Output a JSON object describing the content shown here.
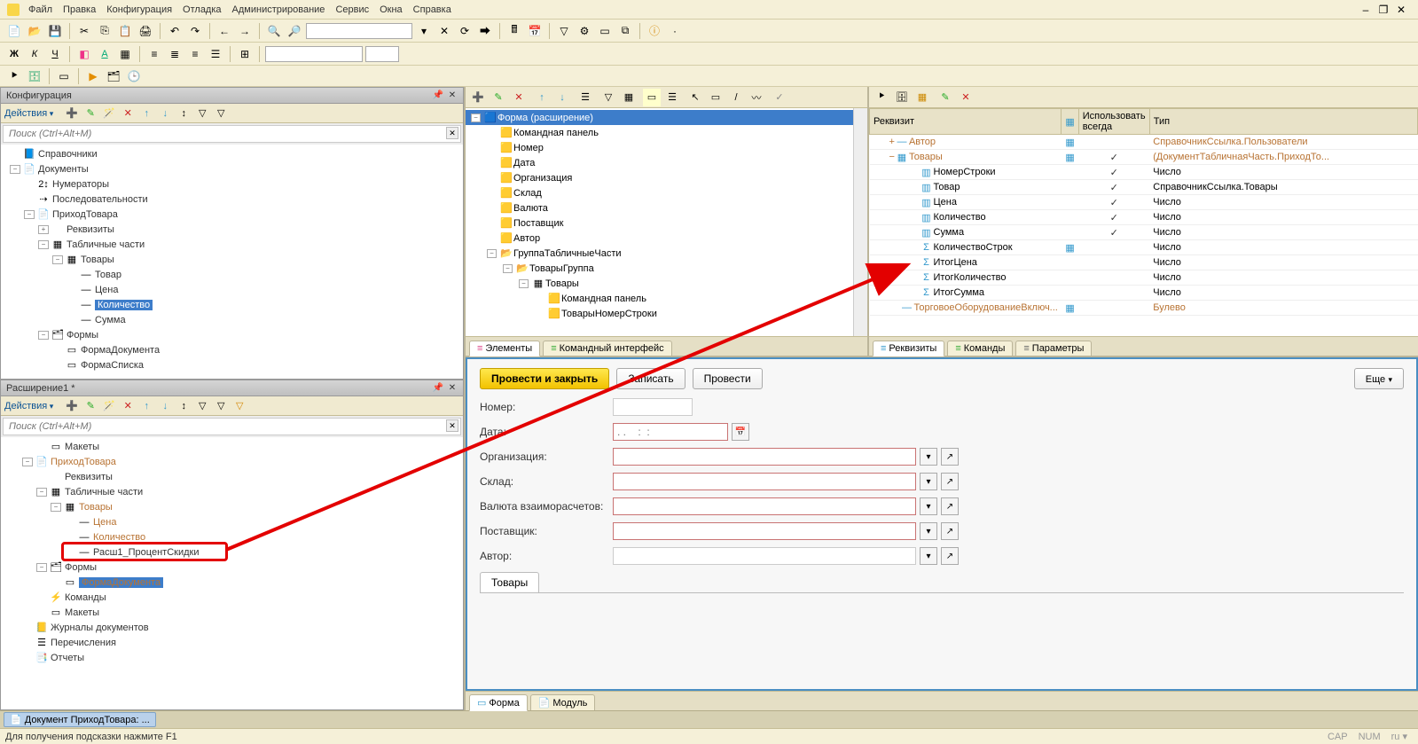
{
  "menu": {
    "file": "Файл",
    "edit": "Правка",
    "config": "Конфигурация",
    "debug": "Отладка",
    "admin": "Администрирование",
    "service": "Сервис",
    "windows": "Окна",
    "help": "Справка"
  },
  "panels": {
    "config": {
      "title": "Конфигурация",
      "actions": "Действия",
      "search_placeholder": "Поиск (Ctrl+Alt+M)",
      "tree": [
        {
          "lvl": 0,
          "exp": "",
          "icon": "📘",
          "label": "Справочники"
        },
        {
          "lvl": 0,
          "exp": "-",
          "icon": "📄",
          "label": "Документы"
        },
        {
          "lvl": 1,
          "exp": "",
          "icon": "2↕",
          "label": "Нумераторы"
        },
        {
          "lvl": 1,
          "exp": "",
          "icon": "⇢",
          "label": "Последовательности"
        },
        {
          "lvl": 1,
          "exp": "-",
          "icon": "📄",
          "label": "ПриходТовара"
        },
        {
          "lvl": 2,
          "exp": "+",
          "icon": "",
          "label": "Реквизиты"
        },
        {
          "lvl": 2,
          "exp": "-",
          "icon": "▦",
          "label": "Табличные части"
        },
        {
          "lvl": 3,
          "exp": "-",
          "icon": "▦",
          "label": "Товары"
        },
        {
          "lvl": 4,
          "exp": "",
          "icon": "—",
          "label": "Товар"
        },
        {
          "lvl": 4,
          "exp": "",
          "icon": "—",
          "label": "Цена"
        },
        {
          "lvl": 4,
          "exp": "",
          "icon": "—",
          "label": "Количество",
          "selected": true
        },
        {
          "lvl": 4,
          "exp": "",
          "icon": "—",
          "label": "Сумма"
        },
        {
          "lvl": 2,
          "exp": "-",
          "icon": "🗂",
          "label": "Формы"
        },
        {
          "lvl": 3,
          "exp": "",
          "icon": "▭",
          "label": "ФормаДокумента"
        },
        {
          "lvl": 3,
          "exp": "",
          "icon": "▭",
          "label": "ФормаСписка"
        }
      ]
    },
    "ext": {
      "title": "Расширение1 *",
      "actions": "Действия",
      "search_placeholder": "Поиск (Ctrl+Alt+M)",
      "tree": [
        {
          "lvl": 1,
          "exp": "",
          "icon": "▭",
          "label": "Макеты"
        },
        {
          "lvl": 0,
          "exp": "-",
          "icon": "📄",
          "label": "ПриходТовара",
          "orange": true
        },
        {
          "lvl": 1,
          "exp": "",
          "icon": "",
          "label": "Реквизиты"
        },
        {
          "lvl": 1,
          "exp": "-",
          "icon": "▦",
          "label": "Табличные части"
        },
        {
          "lvl": 2,
          "exp": "-",
          "icon": "▦",
          "label": "Товары",
          "orange": true
        },
        {
          "lvl": 3,
          "exp": "",
          "icon": "—",
          "label": "Цена",
          "orange": true
        },
        {
          "lvl": 3,
          "exp": "",
          "icon": "—",
          "label": "Количество",
          "orange": true
        },
        {
          "lvl": 3,
          "exp": "",
          "icon": "—",
          "label": "Расш1_ПроцентСкидки",
          "boxed": true
        },
        {
          "lvl": 1,
          "exp": "-",
          "icon": "🗂",
          "label": "Формы"
        },
        {
          "lvl": 2,
          "exp": "",
          "icon": "▭",
          "label": "ФормаДокумента",
          "selected": true,
          "orange": true
        },
        {
          "lvl": 1,
          "exp": "",
          "icon": "⚡",
          "label": "Команды"
        },
        {
          "lvl": 1,
          "exp": "",
          "icon": "▭",
          "label": "Макеты"
        },
        {
          "lvl": 0,
          "exp": "",
          "icon": "📒",
          "label": "Журналы документов"
        },
        {
          "lvl": 0,
          "exp": "",
          "icon": "☰",
          "label": "Перечисления"
        },
        {
          "lvl": 0,
          "exp": "",
          "icon": "📑",
          "label": "Отчеты"
        }
      ]
    }
  },
  "elements": {
    "tree": [
      {
        "lvl": 0,
        "exp": "-",
        "icon": "🟦",
        "label": "Форма (расширение)",
        "selected": true
      },
      {
        "lvl": 1,
        "exp": "",
        "icon": "🟨",
        "label": "Командная панель"
      },
      {
        "lvl": 1,
        "exp": "",
        "icon": "🟨",
        "label": "Номер"
      },
      {
        "lvl": 1,
        "exp": "",
        "icon": "🟨",
        "label": "Дата"
      },
      {
        "lvl": 1,
        "exp": "",
        "icon": "🟨",
        "label": "Организация"
      },
      {
        "lvl": 1,
        "exp": "",
        "icon": "🟨",
        "label": "Склад"
      },
      {
        "lvl": 1,
        "exp": "",
        "icon": "🟨",
        "label": "Валюта"
      },
      {
        "lvl": 1,
        "exp": "",
        "icon": "🟨",
        "label": "Поставщик"
      },
      {
        "lvl": 1,
        "exp": "",
        "icon": "🟨",
        "label": "Автор"
      },
      {
        "lvl": 1,
        "exp": "-",
        "icon": "📂",
        "label": "ГруппаТабличныеЧасти"
      },
      {
        "lvl": 2,
        "exp": "-",
        "icon": "📂",
        "label": "ТоварыГруппа"
      },
      {
        "lvl": 3,
        "exp": "-",
        "icon": "▦",
        "label": "Товары"
      },
      {
        "lvl": 4,
        "exp": "",
        "icon": "🟨",
        "label": "Командная панель"
      },
      {
        "lvl": 4,
        "exp": "",
        "icon": "🟨",
        "label": "ТоварыНомерСтроки"
      }
    ],
    "tabs": {
      "el": "Элементы",
      "cmd": "Командный интерфейс"
    }
  },
  "requisites": {
    "cols": {
      "c1": "Реквизит",
      "c2": "",
      "c3": "Использовать всегда",
      "c4": "Тип"
    },
    "rows": [
      {
        "lvl": 0,
        "exp": "+",
        "icon": "—",
        "name": "Автор",
        "c2": "☑",
        "c3": "",
        "type": "СправочникСсылка.Пользователи",
        "orange": true
      },
      {
        "lvl": 0,
        "exp": "-",
        "icon": "▦",
        "name": "Товары",
        "c2": "☑",
        "c3": "✓",
        "type": "(ДокументТабличнаяЧасть.ПриходТо...",
        "orange": true
      },
      {
        "lvl": 1,
        "exp": "",
        "icon": "▥",
        "name": "НомерСтроки",
        "c2": "",
        "c3": "✓",
        "type": "Число"
      },
      {
        "lvl": 1,
        "exp": "",
        "icon": "▥",
        "name": "Товар",
        "c2": "",
        "c3": "✓",
        "type": "СправочникСсылка.Товары"
      },
      {
        "lvl": 1,
        "exp": "",
        "icon": "▥",
        "name": "Цена",
        "c2": "",
        "c3": "✓",
        "type": "Число"
      },
      {
        "lvl": 1,
        "exp": "",
        "icon": "▥",
        "name": "Количество",
        "c2": "",
        "c3": "✓",
        "type": "Число"
      },
      {
        "lvl": 1,
        "exp": "",
        "icon": "▥",
        "name": "Сумма",
        "c2": "",
        "c3": "✓",
        "type": "Число"
      },
      {
        "lvl": 1,
        "exp": "",
        "icon": "Σ",
        "name": "КоличествоСтрок",
        "c2": "☑",
        "c3": "",
        "type": "Число"
      },
      {
        "lvl": 1,
        "exp": "",
        "icon": "Σ",
        "name": "ИтогЦена",
        "c2": "",
        "c3": "",
        "type": "Число"
      },
      {
        "lvl": 1,
        "exp": "",
        "icon": "Σ",
        "name": "ИтогКоличество",
        "c2": "",
        "c3": "",
        "type": "Число"
      },
      {
        "lvl": 1,
        "exp": "",
        "icon": "Σ",
        "name": "ИтогСумма",
        "c2": "",
        "c3": "",
        "type": "Число"
      },
      {
        "lvl": 0,
        "exp": "",
        "icon": "—",
        "name": "ТорговоеОборудованиеВключ...",
        "c2": "☑",
        "c3": "",
        "type": "Булево",
        "orange": true
      }
    ],
    "tabs": {
      "req": "Реквизиты",
      "cmd": "Команды",
      "par": "Параметры"
    }
  },
  "form": {
    "buttons": {
      "post_close": "Провести и закрыть",
      "write": "Записать",
      "post": "Провести",
      "more": "Еще"
    },
    "fields": {
      "number": "Номер:",
      "date": "Дата:",
      "date_placeholder": ". .    :  :",
      "org": "Организация:",
      "sklad": "Склад:",
      "currency": "Валюта взаиморасчетов:",
      "supplier": "Поставщик:",
      "author": "Автор:"
    },
    "tabs": {
      "goods": "Товары"
    },
    "bottom_tabs": {
      "form": "Форма",
      "module": "Модуль"
    }
  },
  "taskbar": {
    "doc": "Документ ПриходТовара: ..."
  },
  "status": {
    "hint": "Для получения подсказки нажмите F1",
    "cap": "CAP",
    "num": "NUM",
    "lang": "ru ▾"
  }
}
